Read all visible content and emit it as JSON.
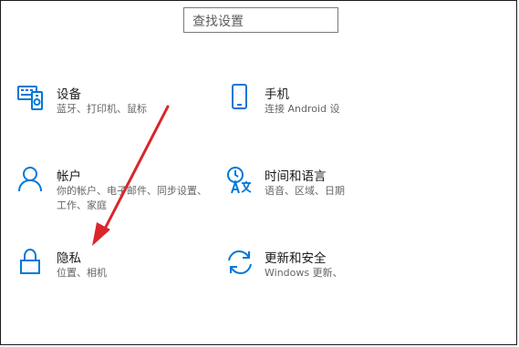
{
  "search": {
    "placeholder": "查找设置"
  },
  "tiles": {
    "devices": {
      "title": "设备",
      "desc_lines": [
        "蓝牙、打印机、鼠标"
      ],
      "icon": "devices-icon"
    },
    "phone": {
      "title": "手机",
      "desc_lines": [
        "连接 Android 设"
      ],
      "icon": "phone-icon"
    },
    "accounts": {
      "title": "帐户",
      "desc_lines": [
        "你的帐户、电子邮件、同步设置、",
        "工作、家庭"
      ],
      "icon": "person-icon"
    },
    "time_language": {
      "title": "时间和语言",
      "desc_lines": [
        "语音、区域、日期"
      ],
      "icon": "time-language-icon"
    },
    "privacy": {
      "title": "隐私",
      "desc_lines": [
        "位置、相机"
      ],
      "icon": "lock-icon"
    },
    "update_security": {
      "title": "更新和安全",
      "desc_lines": [
        "Windows 更新、"
      ],
      "icon": "sync-icon"
    }
  },
  "colors": {
    "accent": "#0078d7",
    "annotation_arrow": "#d9262b"
  }
}
